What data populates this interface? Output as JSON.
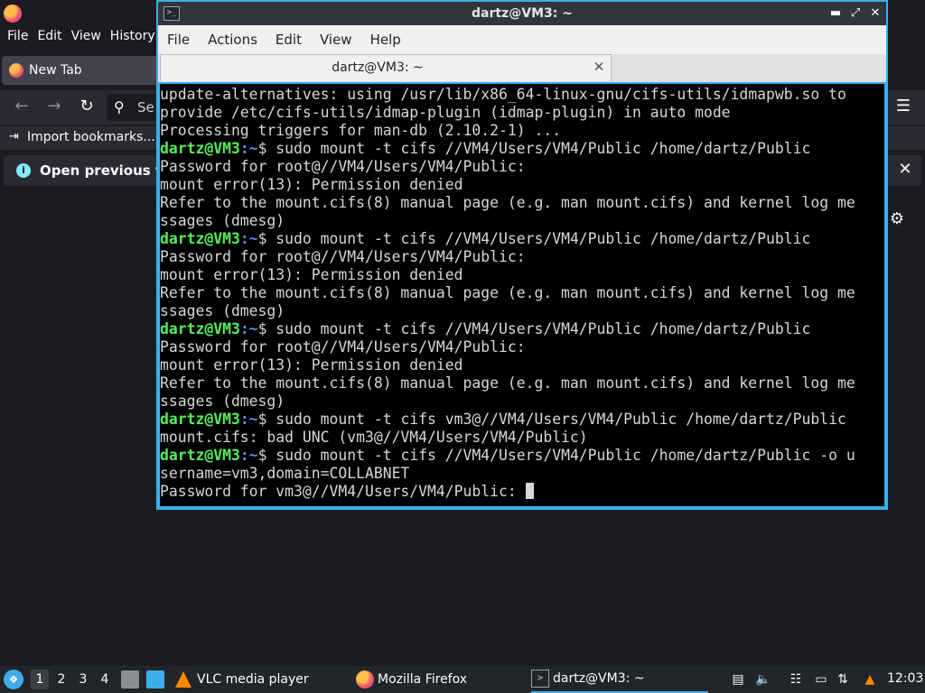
{
  "firefox": {
    "menu": [
      "File",
      "Edit",
      "View",
      "History"
    ],
    "tab_title": "New Tab",
    "search_placeholder": "Se",
    "bookmark_import": "Import bookmarks...",
    "notification_text": "Open previous ta"
  },
  "terminal": {
    "window_title": "dartz@VM3: ~",
    "menu": [
      "File",
      "Actions",
      "Edit",
      "View",
      "Help"
    ],
    "tab_title": "dartz@VM3: ~",
    "lines": [
      {
        "type": "out",
        "text": "update-alternatives: using /usr/lib/x86_64-linux-gnu/cifs-utils/idmapwb.so to"
      },
      {
        "type": "out",
        "text": "provide /etc/cifs-utils/idmap-plugin (idmap-plugin) in auto mode"
      },
      {
        "type": "out",
        "text": "Processing triggers for man-db (2.10.2-1) ..."
      },
      {
        "type": "prompt",
        "user": "dartz@VM3",
        "path": ":~",
        "cmd": "$ sudo mount -t cifs //VM4/Users/VM4/Public /home/dartz/Public"
      },
      {
        "type": "out",
        "text": "Password for root@//VM4/Users/VM4/Public:"
      },
      {
        "type": "out",
        "text": "mount error(13): Permission denied"
      },
      {
        "type": "out",
        "text": "Refer to the mount.cifs(8) manual page (e.g. man mount.cifs) and kernel log me"
      },
      {
        "type": "out",
        "text": "ssages (dmesg)"
      },
      {
        "type": "prompt",
        "user": "dartz@VM3",
        "path": ":~",
        "cmd": "$ sudo mount -t cifs //VM4/Users/VM4/Public /home/dartz/Public"
      },
      {
        "type": "out",
        "text": "Password for root@//VM4/Users/VM4/Public:"
      },
      {
        "type": "out",
        "text": "mount error(13): Permission denied"
      },
      {
        "type": "out",
        "text": "Refer to the mount.cifs(8) manual page (e.g. man mount.cifs) and kernel log me"
      },
      {
        "type": "out",
        "text": "ssages (dmesg)"
      },
      {
        "type": "prompt",
        "user": "dartz@VM3",
        "path": ":~",
        "cmd": "$ sudo mount -t cifs //VM4/Users/VM4/Public /home/dartz/Public"
      },
      {
        "type": "out",
        "text": "Password for root@//VM4/Users/VM4/Public:"
      },
      {
        "type": "out",
        "text": "mount error(13): Permission denied"
      },
      {
        "type": "out",
        "text": "Refer to the mount.cifs(8) manual page (e.g. man mount.cifs) and kernel log me"
      },
      {
        "type": "out",
        "text": "ssages (dmesg)"
      },
      {
        "type": "prompt",
        "user": "dartz@VM3",
        "path": ":~",
        "cmd": "$ sudo mount -t cifs vm3@//VM4/Users/VM4/Public /home/dartz/Public"
      },
      {
        "type": "out",
        "text": "mount.cifs: bad UNC (vm3@//VM4/Users/VM4/Public)"
      },
      {
        "type": "prompt",
        "user": "dartz@VM3",
        "path": ":~",
        "cmd": "$ sudo mount -t cifs //VM4/Users/VM4/Public /home/dartz/Public -o u"
      },
      {
        "type": "out",
        "text": "sername=vm3,domain=COLLABNET"
      },
      {
        "type": "cursor",
        "text": "Password for vm3@//VM4/Users/VM4/Public: "
      }
    ]
  },
  "taskbar": {
    "workspaces": [
      "1",
      "2",
      "3",
      "4"
    ],
    "tasks": {
      "vlc": "VLC media player",
      "firefox": "Mozilla Firefox",
      "terminal": "dartz@VM3: ~"
    },
    "clock": "12:03"
  },
  "colors": {
    "accent": "#3daee9",
    "prompt_user": "#54f05a",
    "prompt_path": "#5c8fe8"
  }
}
